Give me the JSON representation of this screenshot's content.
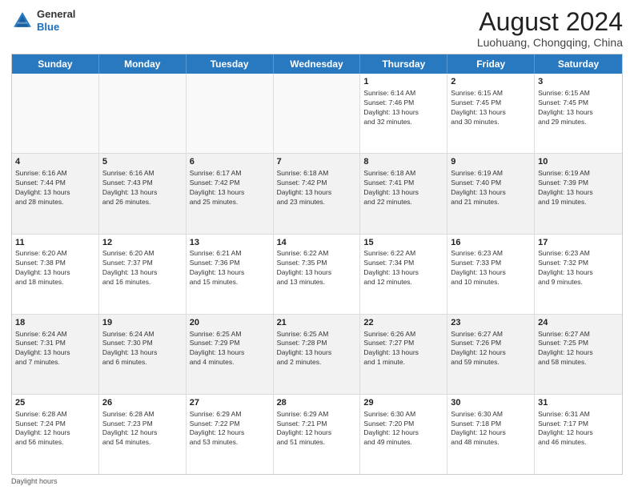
{
  "header": {
    "logo_general": "General",
    "logo_blue": "Blue",
    "month_year": "August 2024",
    "location": "Luohuang, Chongqing, China"
  },
  "calendar": {
    "days_of_week": [
      "Sunday",
      "Monday",
      "Tuesday",
      "Wednesday",
      "Thursday",
      "Friday",
      "Saturday"
    ],
    "rows": [
      [
        {
          "day": "",
          "info": ""
        },
        {
          "day": "",
          "info": ""
        },
        {
          "day": "",
          "info": ""
        },
        {
          "day": "",
          "info": ""
        },
        {
          "day": "1",
          "info": "Sunrise: 6:14 AM\nSunset: 7:46 PM\nDaylight: 13 hours\nand 32 minutes."
        },
        {
          "day": "2",
          "info": "Sunrise: 6:15 AM\nSunset: 7:45 PM\nDaylight: 13 hours\nand 30 minutes."
        },
        {
          "day": "3",
          "info": "Sunrise: 6:15 AM\nSunset: 7:45 PM\nDaylight: 13 hours\nand 29 minutes."
        }
      ],
      [
        {
          "day": "4",
          "info": "Sunrise: 6:16 AM\nSunset: 7:44 PM\nDaylight: 13 hours\nand 28 minutes."
        },
        {
          "day": "5",
          "info": "Sunrise: 6:16 AM\nSunset: 7:43 PM\nDaylight: 13 hours\nand 26 minutes."
        },
        {
          "day": "6",
          "info": "Sunrise: 6:17 AM\nSunset: 7:42 PM\nDaylight: 13 hours\nand 25 minutes."
        },
        {
          "day": "7",
          "info": "Sunrise: 6:18 AM\nSunset: 7:42 PM\nDaylight: 13 hours\nand 23 minutes."
        },
        {
          "day": "8",
          "info": "Sunrise: 6:18 AM\nSunset: 7:41 PM\nDaylight: 13 hours\nand 22 minutes."
        },
        {
          "day": "9",
          "info": "Sunrise: 6:19 AM\nSunset: 7:40 PM\nDaylight: 13 hours\nand 21 minutes."
        },
        {
          "day": "10",
          "info": "Sunrise: 6:19 AM\nSunset: 7:39 PM\nDaylight: 13 hours\nand 19 minutes."
        }
      ],
      [
        {
          "day": "11",
          "info": "Sunrise: 6:20 AM\nSunset: 7:38 PM\nDaylight: 13 hours\nand 18 minutes."
        },
        {
          "day": "12",
          "info": "Sunrise: 6:20 AM\nSunset: 7:37 PM\nDaylight: 13 hours\nand 16 minutes."
        },
        {
          "day": "13",
          "info": "Sunrise: 6:21 AM\nSunset: 7:36 PM\nDaylight: 13 hours\nand 15 minutes."
        },
        {
          "day": "14",
          "info": "Sunrise: 6:22 AM\nSunset: 7:35 PM\nDaylight: 13 hours\nand 13 minutes."
        },
        {
          "day": "15",
          "info": "Sunrise: 6:22 AM\nSunset: 7:34 PM\nDaylight: 13 hours\nand 12 minutes."
        },
        {
          "day": "16",
          "info": "Sunrise: 6:23 AM\nSunset: 7:33 PM\nDaylight: 13 hours\nand 10 minutes."
        },
        {
          "day": "17",
          "info": "Sunrise: 6:23 AM\nSunset: 7:32 PM\nDaylight: 13 hours\nand 9 minutes."
        }
      ],
      [
        {
          "day": "18",
          "info": "Sunrise: 6:24 AM\nSunset: 7:31 PM\nDaylight: 13 hours\nand 7 minutes."
        },
        {
          "day": "19",
          "info": "Sunrise: 6:24 AM\nSunset: 7:30 PM\nDaylight: 13 hours\nand 6 minutes."
        },
        {
          "day": "20",
          "info": "Sunrise: 6:25 AM\nSunset: 7:29 PM\nDaylight: 13 hours\nand 4 minutes."
        },
        {
          "day": "21",
          "info": "Sunrise: 6:25 AM\nSunset: 7:28 PM\nDaylight: 13 hours\nand 2 minutes."
        },
        {
          "day": "22",
          "info": "Sunrise: 6:26 AM\nSunset: 7:27 PM\nDaylight: 13 hours\nand 1 minute."
        },
        {
          "day": "23",
          "info": "Sunrise: 6:27 AM\nSunset: 7:26 PM\nDaylight: 12 hours\nand 59 minutes."
        },
        {
          "day": "24",
          "info": "Sunrise: 6:27 AM\nSunset: 7:25 PM\nDaylight: 12 hours\nand 58 minutes."
        }
      ],
      [
        {
          "day": "25",
          "info": "Sunrise: 6:28 AM\nSunset: 7:24 PM\nDaylight: 12 hours\nand 56 minutes."
        },
        {
          "day": "26",
          "info": "Sunrise: 6:28 AM\nSunset: 7:23 PM\nDaylight: 12 hours\nand 54 minutes."
        },
        {
          "day": "27",
          "info": "Sunrise: 6:29 AM\nSunset: 7:22 PM\nDaylight: 12 hours\nand 53 minutes."
        },
        {
          "day": "28",
          "info": "Sunrise: 6:29 AM\nSunset: 7:21 PM\nDaylight: 12 hours\nand 51 minutes."
        },
        {
          "day": "29",
          "info": "Sunrise: 6:30 AM\nSunset: 7:20 PM\nDaylight: 12 hours\nand 49 minutes."
        },
        {
          "day": "30",
          "info": "Sunrise: 6:30 AM\nSunset: 7:18 PM\nDaylight: 12 hours\nand 48 minutes."
        },
        {
          "day": "31",
          "info": "Sunrise: 6:31 AM\nSunset: 7:17 PM\nDaylight: 12 hours\nand 46 minutes."
        }
      ]
    ],
    "footer": "Daylight hours"
  }
}
